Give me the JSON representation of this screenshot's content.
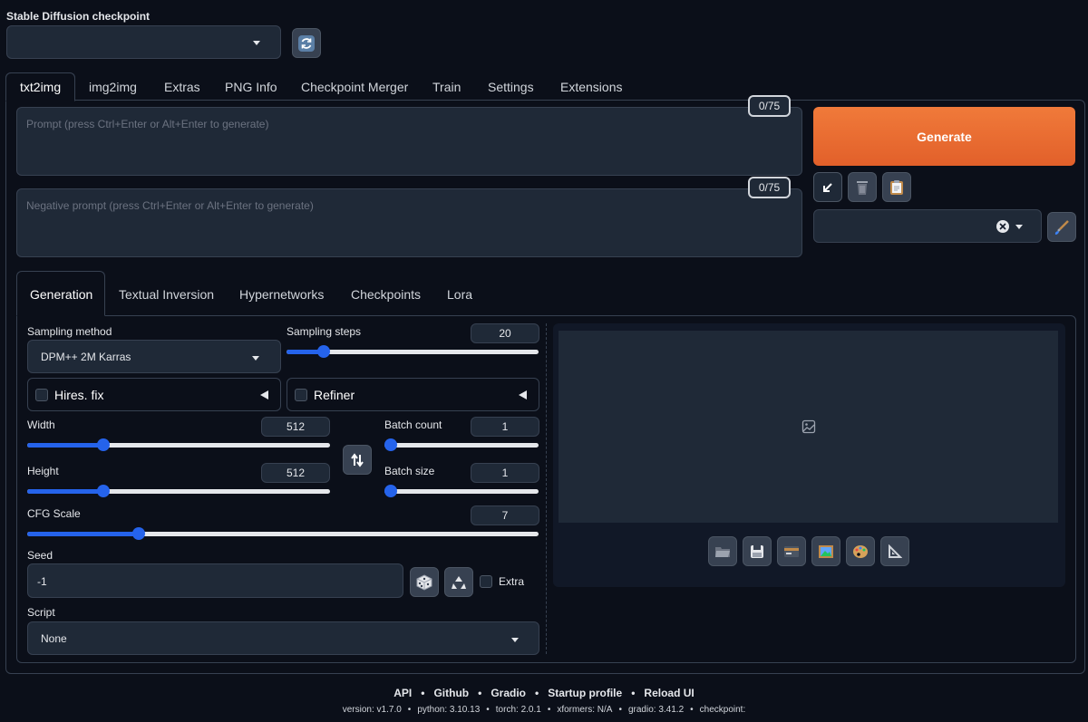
{
  "checkpoint": {
    "label": "Stable Diffusion checkpoint",
    "value": ""
  },
  "main_tabs": [
    "txt2img",
    "img2img",
    "Extras",
    "PNG Info",
    "Checkpoint Merger",
    "Train",
    "Settings",
    "Extensions"
  ],
  "prompt": {
    "placeholder": "Prompt (press Ctrl+Enter or Alt+Enter to generate)",
    "counter": "0/75"
  },
  "negative_prompt": {
    "placeholder": "Negative prompt (press Ctrl+Enter or Alt+Enter to generate)",
    "counter": "0/75"
  },
  "generate_label": "Generate",
  "sub_tabs": [
    "Generation",
    "Textual Inversion",
    "Hypernetworks",
    "Checkpoints",
    "Lora"
  ],
  "sampling_method": {
    "label": "Sampling method",
    "value": "DPM++ 2M Karras"
  },
  "sampling_steps": {
    "label": "Sampling steps",
    "value": "20",
    "fraction": 0.13
  },
  "hires_fix_label": "Hires. fix",
  "refiner_label": "Refiner",
  "width": {
    "label": "Width",
    "value": "512",
    "fraction": 0.24
  },
  "height": {
    "label": "Height",
    "value": "512",
    "fraction": 0.24
  },
  "batch_count": {
    "label": "Batch count",
    "value": "1",
    "fraction": 0.0
  },
  "batch_size": {
    "label": "Batch size",
    "value": "1",
    "fraction": 0.0
  },
  "cfg_scale": {
    "label": "CFG Scale",
    "value": "7",
    "fraction": 0.21
  },
  "seed": {
    "label": "Seed",
    "value": "-1",
    "extra_label": "Extra"
  },
  "script": {
    "label": "Script",
    "value": "None"
  },
  "footer": {
    "links": [
      "API",
      "Github",
      "Gradio",
      "Startup profile",
      "Reload UI"
    ],
    "separator": "•",
    "version": "version: v1.7.0",
    "python": "python: 3.10.13",
    "torch": "torch: 2.0.1",
    "xformers": "xformers: N/A",
    "gradio": "gradio: 3.41.2",
    "checkpoint": "checkpoint:"
  },
  "colors": {
    "accent": "#2563eb",
    "generate": "#ea580c",
    "background": "#0b0f19",
    "panel": "#1f2937"
  },
  "icons": [
    "refresh-icon",
    "arrow-down-left-icon",
    "trash-icon",
    "clipboard-icon",
    "clear-x-icon",
    "paintbrush-icon",
    "swap-icon",
    "dice-icon",
    "recycle-icon",
    "image-placeholder-icon",
    "folder-icon",
    "save-icon",
    "zip-icon",
    "picture-icon",
    "palette-icon",
    "triangle-ruler-icon"
  ]
}
